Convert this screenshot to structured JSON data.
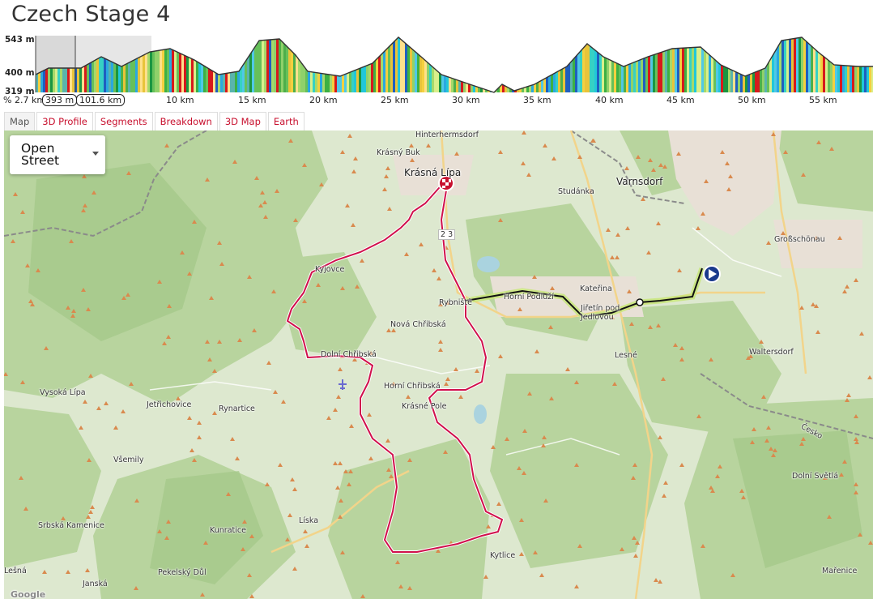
{
  "page": {
    "title": "Czech Stage 4"
  },
  "profile": {
    "elev_labels": [
      "543 m",
      "400 m",
      "319 m"
    ],
    "stats": {
      "grade": "%",
      "distance": "2.7 km",
      "elevation": "393 m",
      "total": "101.6 km"
    },
    "km_ticks": [
      "10 km",
      "15 km",
      "20 km",
      "25 km",
      "30 km",
      "35 km",
      "40 km",
      "45 km",
      "50 km",
      "55 km"
    ]
  },
  "tabs": [
    {
      "label": "Map",
      "active": true
    },
    {
      "label": "3D Profile"
    },
    {
      "label": "Segments"
    },
    {
      "label": "Breakdown"
    },
    {
      "label": "3D Map"
    },
    {
      "label": "Earth"
    }
  ],
  "map": {
    "layer_select": {
      "value": "Open Street"
    },
    "places": [
      "Hinterhermsdorf",
      "Krásný Buk",
      "Krásná Lípa",
      "Studánka",
      "Varnsdorf",
      "Großschönau",
      "Kyjovce",
      "Rybniště",
      "Horní Podluží",
      "Kateřina",
      "Jiřetín pod Jedlovou",
      "Nová Chřibská",
      "Dolní Chřibská",
      "Lesné",
      "Waltersdorf",
      "Horní Chřibská",
      "Krásné Pole",
      "Vysoká Lípa",
      "Jetřichovice",
      "Rynartice",
      "Všemily",
      "Srbská Kamenice",
      "Kunratice",
      "Líska",
      "Pekelský Důl",
      "Janská",
      "Kytlice",
      "Dolní Světlá",
      "Mařenice",
      "Česko",
      "Lešná",
      "2 3"
    ],
    "brand": "Google"
  },
  "colors": {
    "route": "#d0104c",
    "highlight": "#111111",
    "tab_text": "#c8102e"
  }
}
